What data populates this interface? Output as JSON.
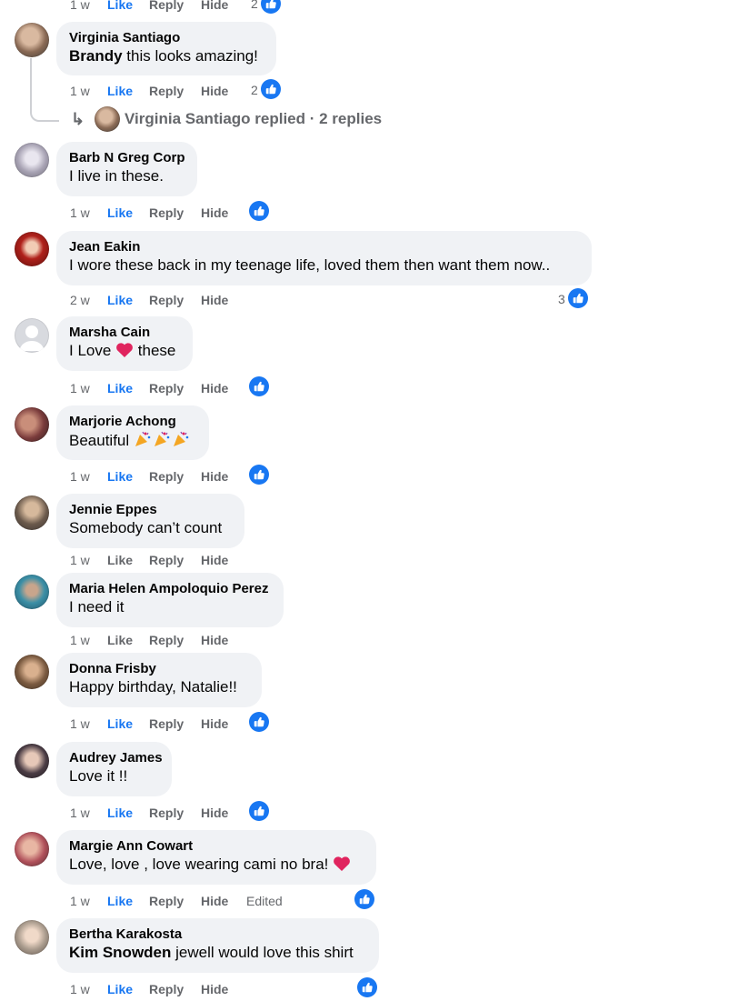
{
  "action_labels": {
    "like": "Like",
    "reply": "Reply",
    "hide": "Hide",
    "edited": "Edited"
  },
  "top_partial": {
    "time": "1 w",
    "reaction_count": "2"
  },
  "comments": [
    {
      "author": "Virginia Santiago",
      "mention": "Brandy",
      "text": " this looks amazing!",
      "time": "1 w",
      "reaction_count": "2",
      "replies_summary": "Virginia Santiago replied · 2 replies"
    },
    {
      "author": "Barb N Greg Corp",
      "text": "I live in these.",
      "time": "1 w"
    },
    {
      "author": "Jean Eakin",
      "text": "I wore these back in my teenage life, loved them then want them now..",
      "time": "2 w",
      "reaction_count": "3"
    },
    {
      "author": "Marsha Cain",
      "text_before": "I Love ",
      "text_after": " these",
      "time": "1 w"
    },
    {
      "author": "Marjorie Achong",
      "text": "Beautiful ",
      "time": "1 w"
    },
    {
      "author": "Jennie Eppes",
      "text": "Somebody can’t count",
      "time": "1 w"
    },
    {
      "author": "Maria Helen Ampoloquio Perez",
      "text": "I need it",
      "time": "1 w"
    },
    {
      "author": "Donna Frisby",
      "text": "Happy birthday, Natalie!!",
      "time": "1 w"
    },
    {
      "author": "Audrey James",
      "text": "Love it !!",
      "time": "1 w"
    },
    {
      "author": "Margie Ann Cowart",
      "text": "Love, love , love wearing cami no bra! ",
      "time": "1 w"
    },
    {
      "author": "Bertha Karakosta",
      "mention": "Kim Snowden",
      "text": " jewell would love this shirt",
      "time": "1 w"
    }
  ],
  "colors": {
    "accent": "#1877f2",
    "bubble": "#f0f2f5",
    "muted": "#65676b"
  }
}
